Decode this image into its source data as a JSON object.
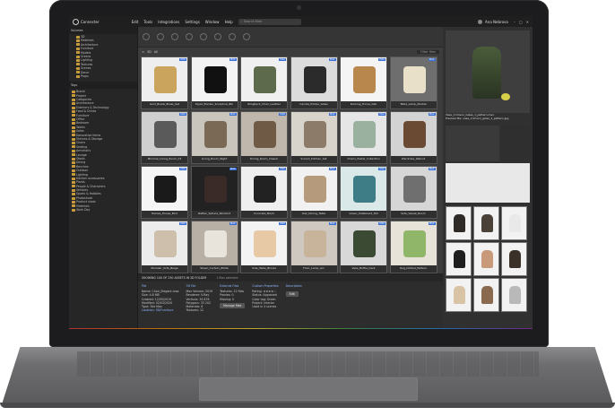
{
  "app": {
    "name": "Connecter",
    "menu": [
      "Edit",
      "Tools",
      "Integrations",
      "Settings",
      "Window",
      "Help"
    ],
    "search_placeholder": "Search files",
    "user": "Ana Nebrova",
    "window_controls": [
      "–",
      "□",
      "✕"
    ]
  },
  "left_panel": {
    "header": "Volumes",
    "tree_top": [
      "3D",
      "Materials",
      "Architecture",
      "Furniture",
      "Models",
      "Greens",
      "Lighting",
      "Textures",
      "Scenes",
      "Decor",
      "Props"
    ],
    "tags_header": "Tags",
    "tree_bottom": [
      "Brand",
      "Project",
      "Categories",
      "Architecture",
      "Exteriors & Technology",
      "Food & Drinks",
      "Furniture",
      "Office",
      "Bedroom",
      "Tables",
      "Sofas",
      "Decorative items",
      "Shelves & Storage",
      "Chairs",
      "Seating",
      "Armchairs",
      "Lounge",
      "Stools",
      "Dining",
      "Benches",
      "Outdoor",
      "Lighting",
      "Kitchen accessories",
      "Plants",
      "People & Characters",
      "Vehicles",
      "Sports & Hobbies",
      "Photoshoot",
      "Product shots",
      "Materials",
      "Work Day"
    ]
  },
  "toolbar": {
    "breadcrumb": [
      "<",
      "3D",
      "All"
    ],
    "filter_placeholder": "Filter files"
  },
  "grid": {
    "items": [
      {
        "caption": "Gold_Bowls_Brass_Set",
        "badge": "MAX",
        "color": "#caa45c",
        "bg": "#eeeeee"
      },
      {
        "caption": "Egret_Planter_Sculpture_Blk",
        "badge": "MAX",
        "color": "#111111",
        "bg": "#f3f3f3"
      },
      {
        "caption": "Wingback_Chair_Leather",
        "badge": "MAX",
        "color": "#5d6b4c",
        "bg": "#f0f0f0"
      },
      {
        "caption": "Candle_Holder_Glass",
        "badge": "MAX",
        "color": "#2b2b2b",
        "bg": "#dcdcdc"
      },
      {
        "caption": "Rocking_Horse_Oak",
        "badge": "MAX",
        "color": "#b8874e",
        "bg": "#f4f4f4"
      },
      {
        "caption": "Table_Lamp_Marble",
        "badge": "MAX",
        "color": "#e8e0c8",
        "bg": "#6e6e6e"
      },
      {
        "caption": "Minimal_Living_Room_03",
        "badge": "MAX",
        "color": "#5a5a5a",
        "bg": "#cfcfcf"
      },
      {
        "caption": "Living_Room_Night",
        "badge": "MAX",
        "color": "#7a6a55",
        "bg": "#c9c4bc"
      },
      {
        "caption": "Dining_Room_Classic",
        "badge": "MAX",
        "color": "#6f5a46",
        "bg": "#bfb7ac"
      },
      {
        "caption": "Scandi_Kitchen_Set",
        "badge": "MAX",
        "color": "#8b7b68",
        "bg": "#d8d4cc"
      },
      {
        "caption": "Chairs_Pastel_Collection",
        "badge": "MAX",
        "color": "#9ab1a0",
        "bg": "#e6e6e6"
      },
      {
        "caption": "Wardrobe_Walnut",
        "badge": "MAX",
        "color": "#6b4a33",
        "bg": "#d3d3d3"
      },
      {
        "caption": "Eames_House_Bird",
        "badge": "MAX",
        "color": "#1a1a1a",
        "bg": "#f5f5f5"
      },
      {
        "caption": "Rattan_Sphere_Pendant",
        "badge": "MAX",
        "color": "#3a2b28",
        "bg": "#222222"
      },
      {
        "caption": "Concrete_Block",
        "badge": "MAX",
        "color": "#222222",
        "bg": "#efefef"
      },
      {
        "caption": "Oak_Dining_Table",
        "badge": "MAX",
        "color": "#b69a7c",
        "bg": "#f1f1f1"
      },
      {
        "caption": "Green_Sideboard_Tall",
        "badge": "MAX",
        "color": "#3f7d86",
        "bg": "#dbe8e8"
      },
      {
        "caption": "Sofa_Velvet_Room",
        "badge": "MAX",
        "color": "#6f6f6f",
        "bg": "#d6d6d6"
      },
      {
        "caption": "Modular_Sofa_Beige",
        "badge": "MAX",
        "color": "#cdbfac",
        "bg": "#ececec"
      },
      {
        "caption": "Sheer_Curtain_White",
        "badge": "MAX",
        "color": "#e9e4db",
        "bg": "#b8b0a5"
      },
      {
        "caption": "Side_Table_Blocks",
        "badge": "MAX",
        "color": "#e7c9a6",
        "bg": "#f3f3f3"
      },
      {
        "caption": "Floor_Lamp_Arc",
        "badge": "MAX",
        "color": "#c7b49a",
        "bg": "#cfc8c0"
      },
      {
        "caption": "Vase_Bottle_Dark",
        "badge": "MAX",
        "color": "#3b4a33",
        "bg": "#d8d8d8"
      },
      {
        "caption": "Rug_Dotted_Pattern",
        "badge": "MAX",
        "color": "#90b66a",
        "bg": "#e7e3d8"
      }
    ]
  },
  "info": {
    "header": "SHOWING 100 OF 230 ASSETS IN 3D FOLDER",
    "subheader": "1 files selected",
    "file": {
      "title": "File",
      "lines": [
        "Name: Chair_Elegant.max",
        "Size: 4.8 MB",
        "Created: 12/05/2019",
        "Modified: 02/03/2020",
        "Type: 3ds Max",
        "Location: 3D/Furniture"
      ]
    },
    "max": {
      "title": "3D File",
      "lines": [
        "Max Version: 2019",
        "Renderer: V-Ray",
        "Vertices: 34 876",
        "Polygons: 33 202",
        "Materials: 6",
        "Textures: 12"
      ]
    },
    "external": {
      "title": "External Files",
      "lines": [
        "Textures: 12 files",
        "Proxies: 0",
        "Missing: 0"
      ],
      "button": "Manage files"
    },
    "custom": {
      "title": "Custom Properties",
      "lines": [
        "Rating: ★★★★☆",
        "Status: Approved",
        "Color tag: Green",
        "Project: Interior",
        "Used in 4 scenes"
      ]
    },
    "desc": {
      "title": "Description",
      "button": "Edit"
    }
  },
  "right_panel": {
    "preview_caption": [
      "Vase_Crimson_Glass_1_pattern.max",
      "Preview file: vase_crimson_glass_1_pattern.jpg"
    ],
    "thumb_colors": [
      "#2d2a27",
      "#4a4238",
      "#e9e9e9",
      "#1e1e1e",
      "#c89a7a",
      "#3a3128",
      "#d8c3a5",
      "#8a6a4e",
      "#b9b9b9"
    ]
  }
}
